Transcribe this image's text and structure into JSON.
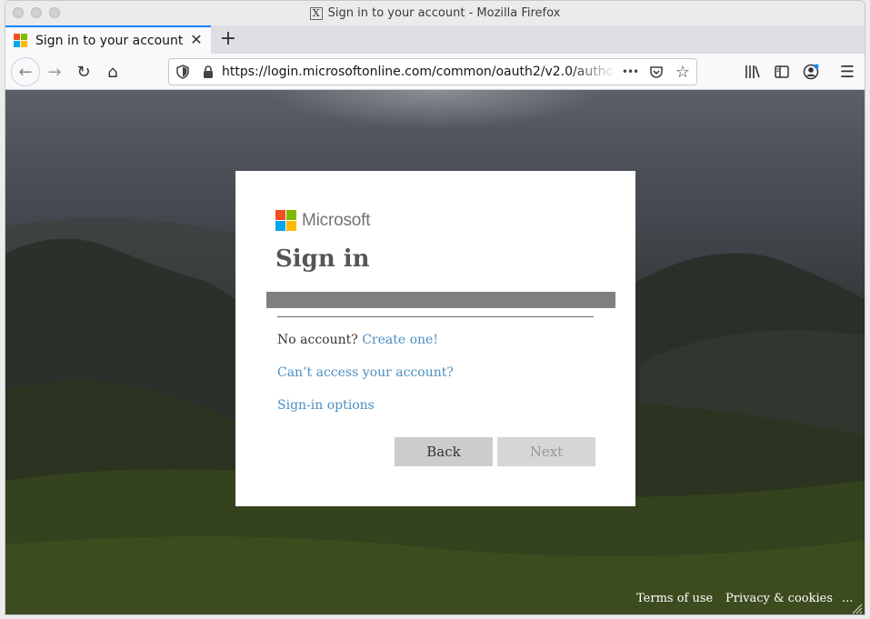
{
  "window": {
    "title": "Sign in to your account - Mozilla Firefox"
  },
  "tabs": [
    {
      "label": "Sign in to your account",
      "active": true
    }
  ],
  "navbar": {
    "url": "https://login.microsoftonline.com/common/oauth2/v2.0/autho"
  },
  "icons": {
    "close": "✕",
    "newtab": "+",
    "back": "←",
    "forward": "→",
    "reload": "↻",
    "home": "⌂",
    "more": "•••",
    "star": "☆",
    "menu": "☰",
    "title_icon": "X"
  },
  "brand_colors": {
    "ms_red": "#f25022",
    "ms_green": "#7fba00",
    "ms_blue": "#00a4ef",
    "ms_yellow": "#ffb900",
    "link": "#4a8ec2"
  },
  "card": {
    "brand": "Microsoft",
    "title": "Sign in",
    "no_account_text": "No account?",
    "create_link": "Create one!",
    "cant_access_link": "Can’t access your account?",
    "signin_options_link": "Sign-in options",
    "back_label": "Back",
    "next_label": "Next"
  },
  "footer": {
    "terms": "Terms of use",
    "privacy": "Privacy & cookies",
    "more": "..."
  }
}
